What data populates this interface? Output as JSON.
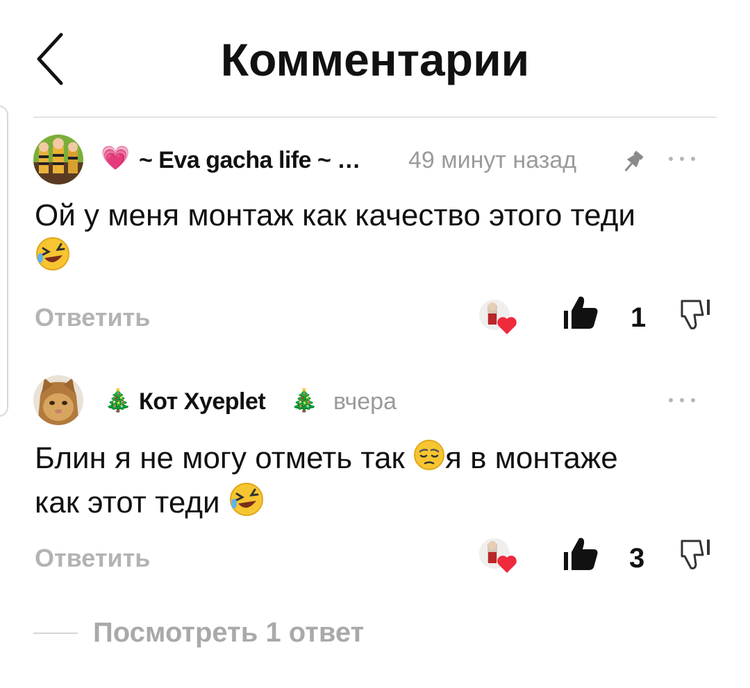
{
  "header": {
    "title": "Комментарии"
  },
  "comments": [
    {
      "prefix": "💗",
      "author": "~ Eva gacha life ~ …",
      "time": "49 минут назад",
      "pinned": true,
      "text": "Ой у меня монтаж как качество этого теди",
      "emoji_trailing": "rofl-face",
      "reply_label": "Ответить",
      "likes": "1",
      "creator_liked": true
    },
    {
      "prefix": "🎄",
      "author": "Кот Xyeplet",
      "suffix": "🎄",
      "time": "вчера",
      "pinned": false,
      "text_part1": "Блин я не могу отметь так",
      "text_part2": "я в монтаже",
      "text_part3": "как этот теди",
      "reply_label": "Ответить",
      "likes": "3",
      "creator_liked": true
    }
  ],
  "view_replies": "Посмотреть 1 ответ",
  "colors": {
    "text": "#111111",
    "muted": "#9a9a9a",
    "reply": "#b3b3b3",
    "divider": "#e3e3e3"
  }
}
